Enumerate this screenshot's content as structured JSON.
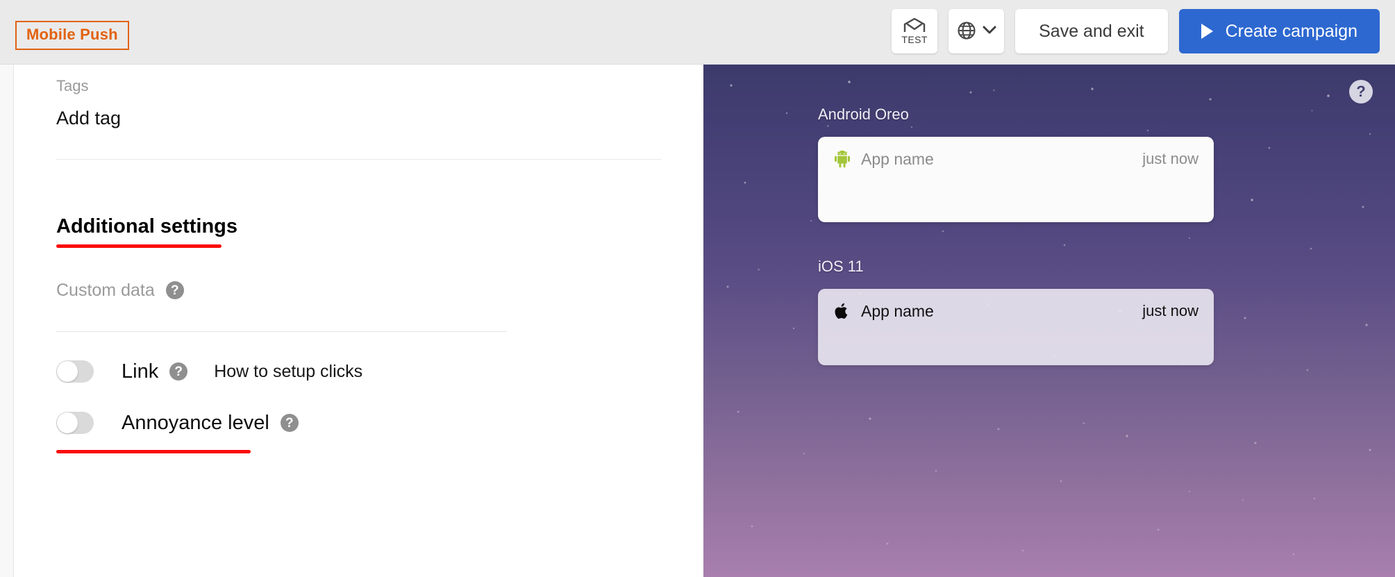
{
  "topbar": {
    "brand_badge": "Mobile Push",
    "test_button": {
      "label": "TEST",
      "icon": "envelope-test-icon"
    },
    "language_button": {
      "icon": "globe-icon",
      "chevron": "chevron-down-icon"
    },
    "save_exit_label": "Save and exit",
    "create_campaign_label": "Create campaign",
    "primary_color": "#2d68d0",
    "brand_color": "#e2620f"
  },
  "form": {
    "tags": {
      "label": "Tags",
      "value": "Add tag"
    },
    "additional_settings": {
      "title": "Additional settings",
      "custom_data": {
        "label": "Custom data",
        "help": "?"
      },
      "link_row": {
        "label": "Link",
        "help": "?",
        "toggle_state": "off",
        "side_link": "How to setup clicks"
      },
      "annoyance_row": {
        "label": "Annoyance level",
        "help": "?",
        "toggle_state": "off"
      }
    },
    "annotation_color": "#fb0a0a"
  },
  "preview": {
    "help_button": "?",
    "background_top_color": "#3c3a6b",
    "background_bottom_color": "#a87fae",
    "devices": [
      {
        "os_label": "Android Oreo",
        "platform": "android",
        "app_name": "App name",
        "time": "just now"
      },
      {
        "os_label": "iOS 11",
        "platform": "ios",
        "app_name": "App name",
        "time": "just now"
      }
    ]
  }
}
